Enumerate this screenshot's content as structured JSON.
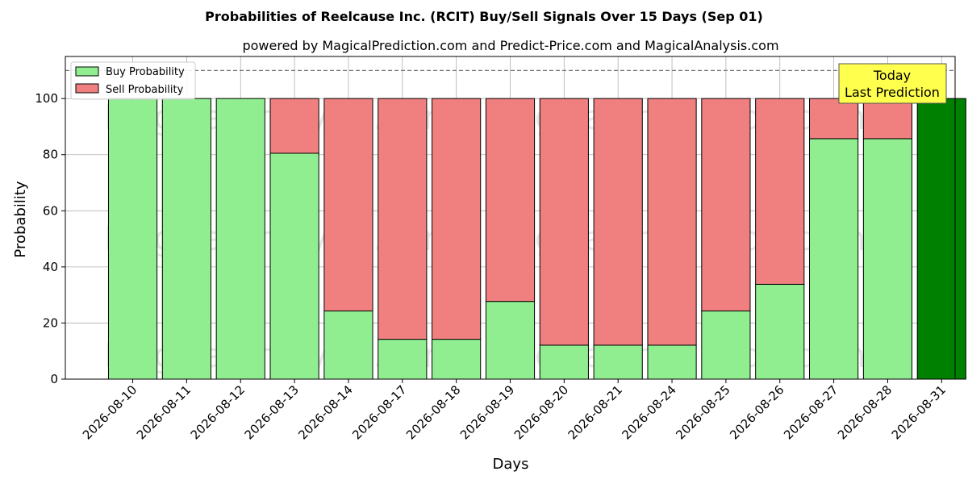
{
  "chart_data": {
    "type": "bar",
    "stacked": true,
    "title": "Probabilities of Reelcause Inc. (RCIT) Buy/Sell Signals Over 15 Days (Sep 01)",
    "subtitle": "powered by MagicalPrediction.com and Predict-Price.com and MagicalAnalysis.com",
    "xlabel": "Days",
    "ylabel": "Probability",
    "ylim": [
      0,
      115
    ],
    "yticks": [
      0,
      20,
      40,
      60,
      80,
      100
    ],
    "grid": true,
    "legend_position": "top-left",
    "reference_line": 110,
    "categories": [
      "2026-08-10",
      "2026-08-11",
      "2026-08-12",
      "2026-08-13",
      "2026-08-14",
      "2026-08-17",
      "2026-08-18",
      "2026-08-19",
      "2026-08-20",
      "2026-08-21",
      "2026-08-24",
      "2026-08-25",
      "2026-08-26",
      "2026-08-27",
      "2026-08-28",
      "2026-08-31"
    ],
    "series": [
      {
        "name": "Buy Probability",
        "color": "#90ee90",
        "values": [
          100,
          100,
          100,
          80.5,
          24.3,
          14.2,
          14.2,
          27.7,
          12.1,
          12.1,
          12.1,
          24.3,
          33.8,
          85.7,
          85.7,
          100
        ]
      },
      {
        "name": "Sell Probability",
        "color": "#f08080",
        "values": [
          0,
          0,
          0,
          19.5,
          75.7,
          85.8,
          85.8,
          72.3,
          87.9,
          87.9,
          87.9,
          75.7,
          66.2,
          14.3,
          14.3,
          0
        ]
      }
    ],
    "highlight": {
      "index": 15,
      "color": "#008000"
    },
    "annotation": {
      "line1": "Today",
      "line2": "Last Prediction",
      "color": "#ffff4d"
    },
    "watermarks": [
      "MagicalAnalysis.com",
      "MagicalPrediction.com"
    ]
  }
}
